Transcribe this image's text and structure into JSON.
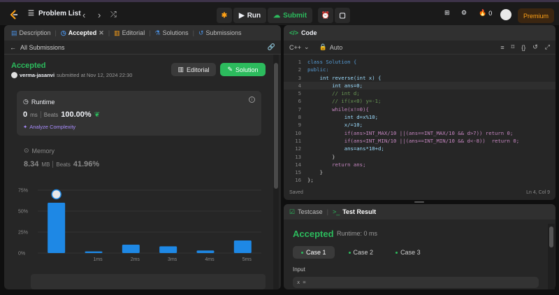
{
  "topbar": {
    "problem_list": "Problem List",
    "run": "Run",
    "submit": "Submit",
    "streak_count": "0",
    "premium": "Premium"
  },
  "left_tabs": [
    {
      "label": "Description",
      "icon": "description-icon"
    },
    {
      "label": "Accepted",
      "icon": "clock-icon"
    },
    {
      "label": "Editorial",
      "icon": "book-icon"
    },
    {
      "label": "Solutions",
      "icon": "flask-icon"
    },
    {
      "label": "Submissions",
      "icon": "history-icon"
    }
  ],
  "subbar": {
    "back_label": "All Submissions"
  },
  "result": {
    "status": "Accepted",
    "username": "verma-jasanvi",
    "submitted_text": "submitted at Nov 12, 2024 22:30",
    "editorial_btn": "Editorial",
    "solution_btn": "Solution"
  },
  "runtime": {
    "label": "Runtime",
    "value": "0",
    "unit": "ms",
    "beats_label": "Beats",
    "beats_value": "100.00%",
    "analyze": "Analyze Complexity"
  },
  "memory": {
    "label": "Memory",
    "value": "8.34",
    "unit": "MB",
    "beats_label": "Beats",
    "beats_value": "41.96%"
  },
  "chart_data": {
    "type": "bar",
    "categories": [
      "",
      "1ms",
      "2ms",
      "3ms",
      "4ms",
      "5ms"
    ],
    "values": [
      60,
      2,
      10,
      8,
      3,
      15
    ],
    "yticks": [
      "75%",
      "50%",
      "25%",
      "0%"
    ],
    "ylim": [
      0,
      75
    ],
    "bar_color": "#1e88e5",
    "highlight_index": 0
  },
  "code_panel": {
    "title": "Code",
    "language": "C++",
    "mode": "Auto",
    "saved": "Saved",
    "cursor": "Ln 4, Col 9",
    "lines": [
      "class Solution {",
      "public:",
      "    int reverse(int x) {",
      "        int ans=0;",
      "        // int d;",
      "        // if(x<0) y=-1;",
      "        while(x!=0){",
      "            int d=x%10;",
      "            x/=10;",
      "            if(ans>INT_MAX/10 ||(ans==INT_MAX/10 && d>7)) return 0;",
      "            if(ans<INT_MIN/10 ||(ans==INT_MIN/10 && d<-8))  return 0;",
      "            ans=ans*10+d;",
      "        }",
      "        return ans;",
      "    }",
      "};"
    ]
  },
  "test_panel": {
    "testcase_tab": "Testcase",
    "result_tab": "Test Result",
    "status": "Accepted",
    "runtime": "Runtime: 0 ms",
    "cases": [
      "Case 1",
      "Case 2",
      "Case 3"
    ],
    "input_label": "Input",
    "input_value": "x ="
  }
}
